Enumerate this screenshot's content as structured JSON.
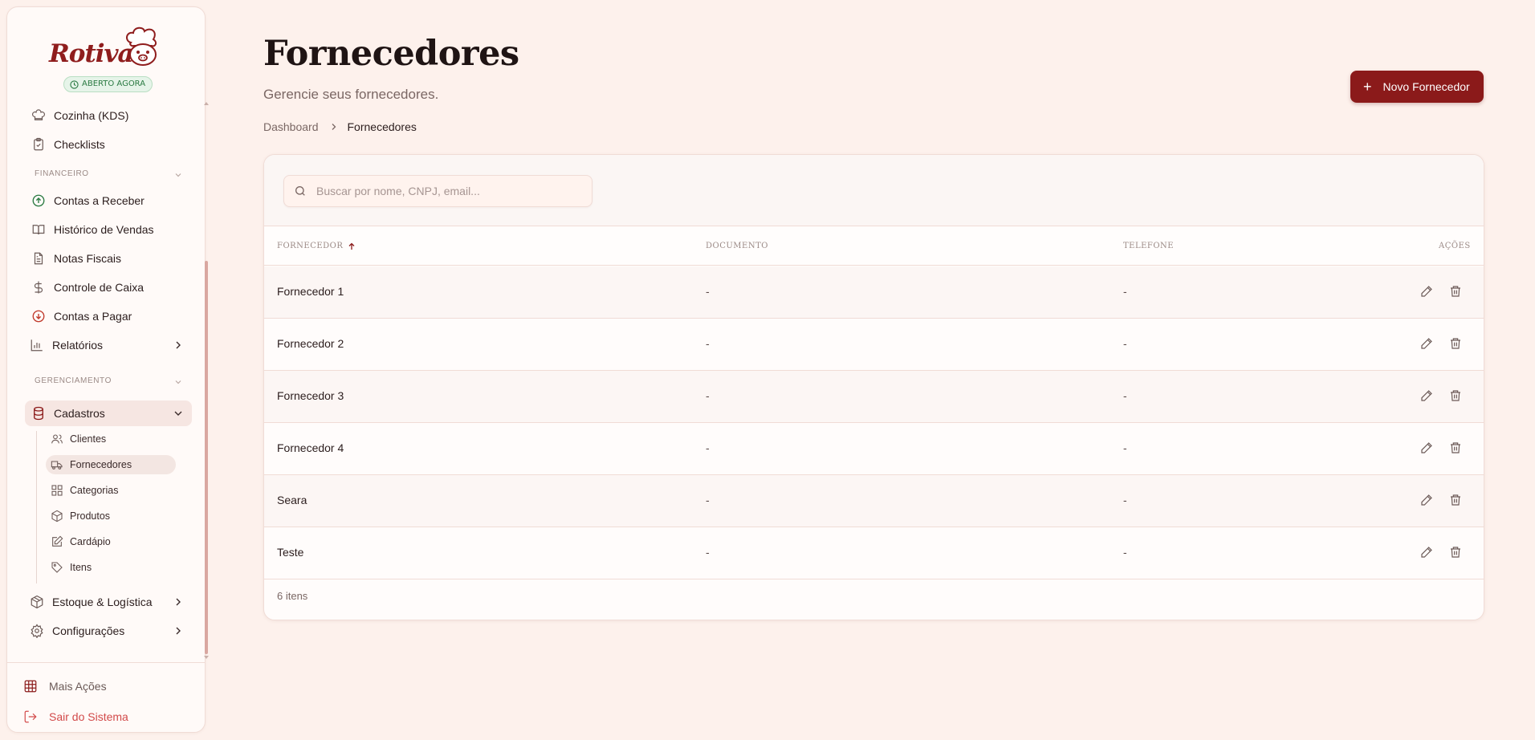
{
  "sidebar": {
    "brand": "Rotiva",
    "status_badge": "ABERTO AGORA",
    "items_top": [
      {
        "label": "Cozinha (KDS)",
        "icon": "chef-hat-icon"
      },
      {
        "label": "Checklists",
        "icon": "clipboard-check-icon"
      }
    ],
    "financeiro": {
      "title": "FINANCEIRO",
      "items": [
        {
          "label": "Contas a Receber",
          "icon": "arrow-up-circle-icon"
        },
        {
          "label": "Histórico de Vendas",
          "icon": "book-open-icon"
        },
        {
          "label": "Notas Fiscais",
          "icon": "file-text-icon"
        },
        {
          "label": "Controle de Caixa",
          "icon": "dollar-icon"
        },
        {
          "label": "Contas a Pagar",
          "icon": "arrow-down-circle-icon"
        },
        {
          "label": "Relatórios",
          "icon": "bar-chart-icon"
        }
      ]
    },
    "gerenciamento": {
      "title": "GERENCIAMENTO",
      "group_label": "Cadastros",
      "sub_items": [
        {
          "label": "Clientes",
          "icon": "users-icon"
        },
        {
          "label": "Fornecedores",
          "icon": "truck-icon"
        },
        {
          "label": "Categorias",
          "icon": "grid-icon"
        },
        {
          "label": "Produtos",
          "icon": "box-icon"
        },
        {
          "label": "Cardápio",
          "icon": "edit-square-icon"
        },
        {
          "label": "Itens",
          "icon": "tag-icon"
        }
      ],
      "more": [
        {
          "label": "Estoque & Logística",
          "icon": "package-icon"
        },
        {
          "label": "Configurações",
          "icon": "settings-icon"
        }
      ]
    },
    "bottom": {
      "more_actions": "Mais Ações",
      "logout": "Sair do Sistema"
    }
  },
  "header": {
    "title": "Fornecedores",
    "subtitle": "Gerencie seus fornecedores.",
    "breadcrumb": [
      "Dashboard",
      "Fornecedores"
    ],
    "new_button": "Novo Fornecedor"
  },
  "search": {
    "placeholder": "Buscar por nome, CNPJ, email..."
  },
  "table": {
    "columns": [
      "FORNECEDOR",
      "DOCUMENTO",
      "TELEFONE",
      "AÇÕES"
    ],
    "rows": [
      {
        "name": "Fornecedor 1",
        "documento": "-",
        "telefone": "-"
      },
      {
        "name": "Fornecedor 2",
        "documento": "-",
        "telefone": "-"
      },
      {
        "name": "Fornecedor 3",
        "documento": "-",
        "telefone": "-"
      },
      {
        "name": "Fornecedor 4",
        "documento": "-",
        "telefone": "-"
      },
      {
        "name": "Seara",
        "documento": "-",
        "telefone": "-"
      },
      {
        "name": "Teste",
        "documento": "-",
        "telefone": "-"
      }
    ],
    "footer": "6 itens"
  },
  "colors": {
    "brand": "#8b1a1a",
    "background": "#fdf1ec",
    "status_green": "#2a7a42",
    "logout_red": "#c0392b"
  }
}
